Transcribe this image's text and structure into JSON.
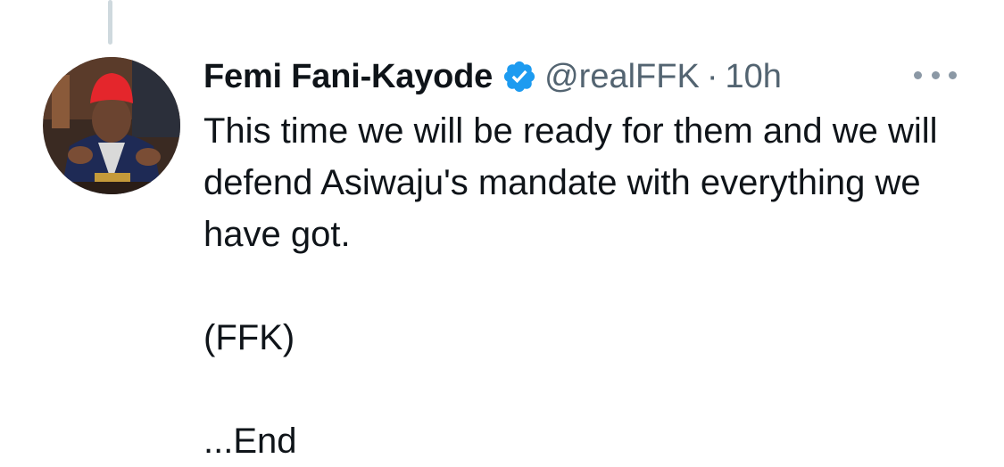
{
  "tweet": {
    "author": {
      "display_name": "Femi Fani-Kayode",
      "handle": "@realFFK",
      "verified": true,
      "avatar_icon": "profile-photo"
    },
    "separator": "·",
    "time": "10h",
    "more_icon": "ellipsis-icon",
    "paragraphs": [
      "This time we will be ready for them and we will defend Asiwaju's mandate with everything we have got.",
      "(FFK)",
      "...End"
    ]
  },
  "colors": {
    "verified": "#1d9bf0",
    "text": "#0f1419",
    "secondary_text": "#536471",
    "thread_line": "#cfd9de"
  }
}
